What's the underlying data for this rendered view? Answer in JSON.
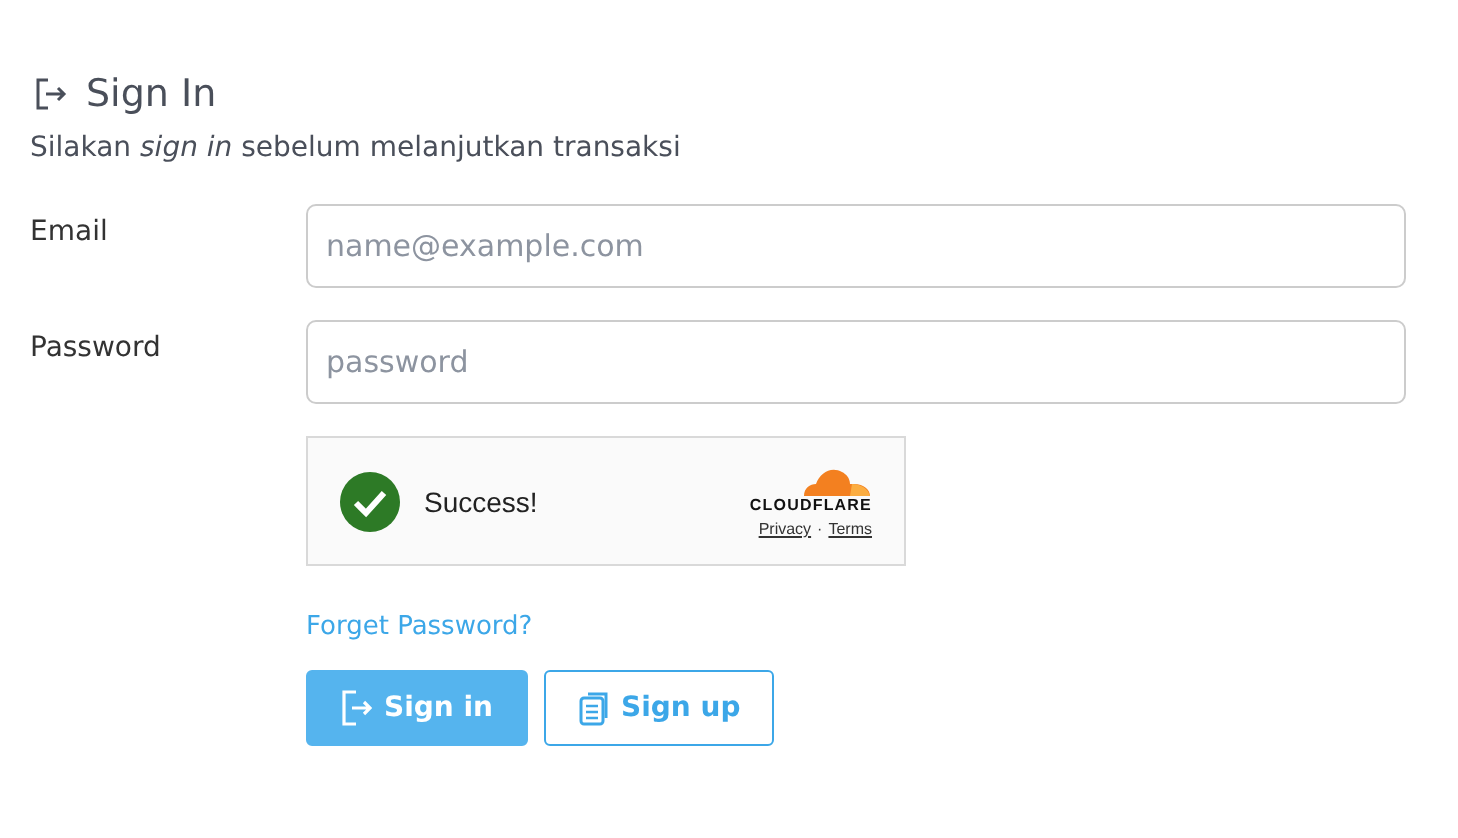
{
  "heading": {
    "title": "Sign In",
    "subtitle": "Silakan *sign in* sebelum melanjutkan transaksi"
  },
  "fields": [
    {
      "label": "Email",
      "placeholder": "name@example.com"
    },
    {
      "label": "Password",
      "placeholder": "password"
    }
  ],
  "captcha": {
    "checked": true,
    "message": "Success!",
    "brand": "CLOUDFLARE",
    "links": [
      "Privacy",
      "Terms"
    ],
    "separator": "·"
  },
  "forgot_link": "Forget Password?",
  "buttons": [
    {
      "label": "Sign in",
      "kind": "primary"
    },
    {
      "label": "Sign up",
      "kind": "outline"
    }
  ]
}
